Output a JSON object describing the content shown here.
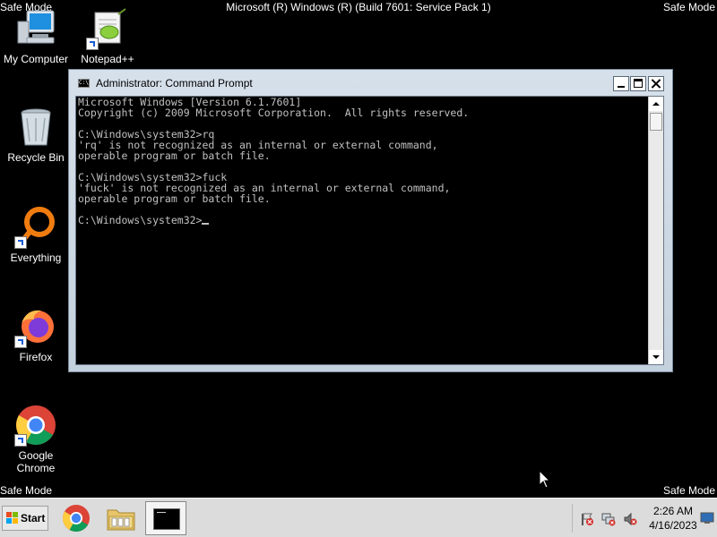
{
  "screen": {
    "safe_mode_label": "Safe Mode",
    "build_text": "Microsoft (R) Windows (R) (Build 7601: Service Pack 1)"
  },
  "desktop_icons": [
    {
      "label": "My Computer",
      "icon": "computer-icon"
    },
    {
      "label": "Notepad++",
      "icon": "notepad-plus-plus-icon"
    },
    {
      "label": "Recycle Bin",
      "icon": "recycle-bin-icon"
    },
    {
      "label": "Everything",
      "icon": "everything-search-icon"
    },
    {
      "label": "Firefox",
      "icon": "firefox-icon"
    },
    {
      "label": "Google Chrome",
      "icon": "chrome-icon"
    }
  ],
  "cmd_window": {
    "title": "Administrator: Command Prompt",
    "icon_text": "C:\\_",
    "lines": [
      "Microsoft Windows [Version 6.1.7601]",
      "Copyright (c) 2009 Microsoft Corporation.  All rights reserved.",
      "",
      "C:\\Windows\\system32>rq",
      "'rq' is not recognized as an internal or external command,",
      "operable program or batch file.",
      "",
      "C:\\Windows\\system32>fuck",
      "'fuck' is not recognized as an internal or external command,",
      "operable program or batch file.",
      ""
    ],
    "prompt": "C:\\Windows\\system32>",
    "text_color": "#c0c0c0",
    "background": "#000000"
  },
  "taskbar": {
    "start_label": "Start",
    "pinned": [
      {
        "name": "chrome",
        "icon": "chrome-icon"
      },
      {
        "name": "explorer",
        "icon": "folder-icon"
      },
      {
        "name": "command-prompt",
        "icon": "command-prompt-icon",
        "active": true
      }
    ],
    "tray_icons": [
      "action-center-flag-icon",
      "network-icon",
      "volume-muted-icon"
    ],
    "clock": {
      "time": "2:26 AM",
      "date": "4/16/2023"
    }
  }
}
